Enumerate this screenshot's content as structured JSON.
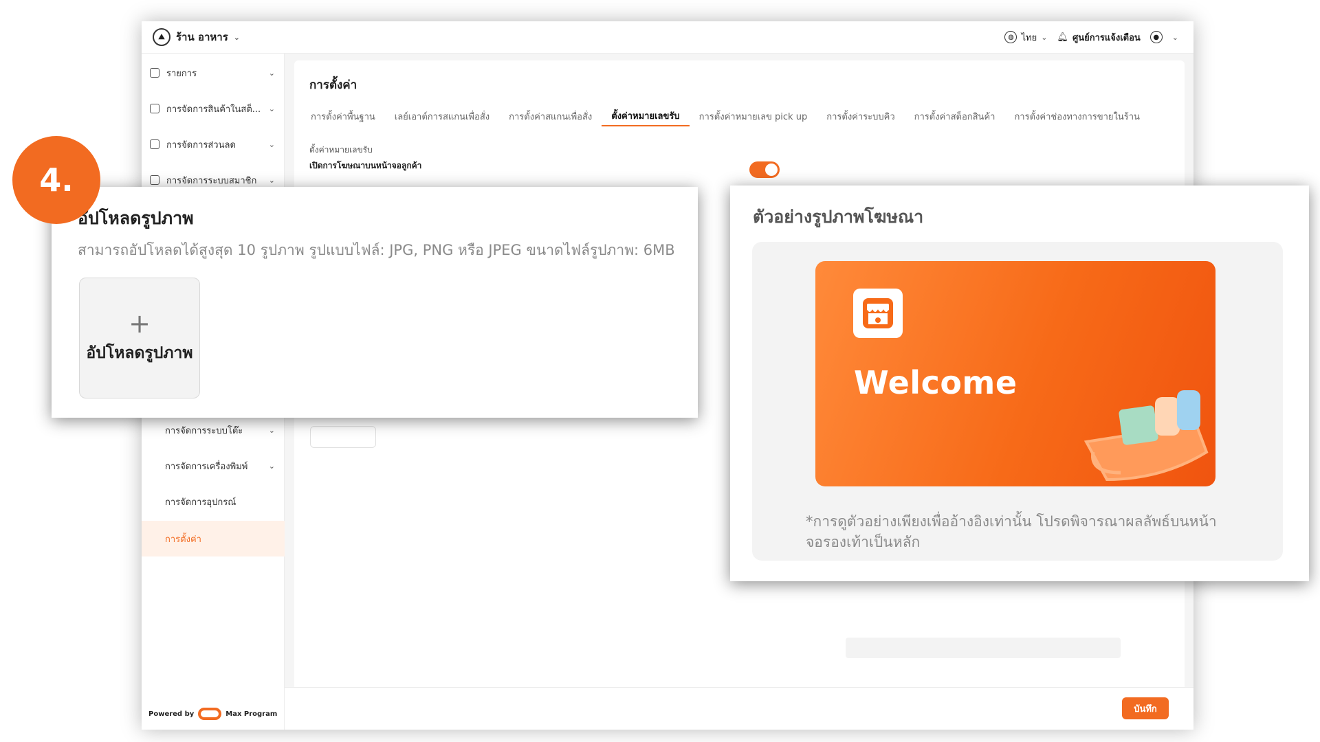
{
  "header": {
    "store_name": "ร้าน อาหาร",
    "language": "ไทย",
    "notification_center": "ศูนย์การแจ้งเตือน"
  },
  "sidebar": {
    "items": [
      {
        "label": "รายการ"
      },
      {
        "label": "การจัดการสินค้าในสต็..."
      },
      {
        "label": "การจัดการส่วนลด"
      },
      {
        "label": "การจัดการระบบสมาชิก"
      },
      {
        "label": "การจัดการระบบโต๊ะ"
      },
      {
        "label": "การจัดการเครื่องพิมพ์"
      },
      {
        "label": "การจัดการอุปกรณ์"
      },
      {
        "label": "การตั้งค่า"
      }
    ],
    "powered_by": "Powered by",
    "brand": "Max Program"
  },
  "main": {
    "title": "การตั้งค่า",
    "tabs": [
      "การตั้งค่าพื้นฐาน",
      "เลย์เอาต์การสแกนเพื่อสั่ง",
      "การตั้งค่าสแกนเพื่อสั่ง",
      "ตั้งค่าหมายเลขรับ",
      "การตั้งค่าหมายเลข pick up",
      "การตั้งค่าระบบคิว",
      "การตั้งค่าสต็อกสินค้า",
      "การตั้งค่าช่องทางการขายในร้าน"
    ],
    "active_tab": "ตั้งค่าหมายเลขรับ",
    "section_label": "ตั้งค่าหมายเลขรับ",
    "ad_toggle_label": "เปิดการโฆษณาบนหน้าจอลูกค้า",
    "ad_toggle_on": true,
    "save_button": "บันทึก"
  },
  "step_badge": "4.",
  "upload_panel": {
    "title": "อัปโหลดรูปภาพ",
    "description": "สามารถอัปโหลดได้สูงสุด 10 รูปภาพ รูปแบบไฟล์: JPG, PNG หรือ JPEG ขนาดไฟล์รูปภาพ: 6MB",
    "upload_button": "อัปโหลดรูปภาพ"
  },
  "preview_panel": {
    "title": "ตัวอย่างรูปภาพโฆษณา",
    "banner_text": "Welcome",
    "note": "*การดูตัวอย่างเพียงเพื่ออ้างอิงเท่านั้น โปรดพิจารณาผลลัพธ์บนหน้าจอรองเท้าเป็นหลัก"
  },
  "colors": {
    "accent": "#f26b21",
    "active_bg": "#fff1e8"
  }
}
